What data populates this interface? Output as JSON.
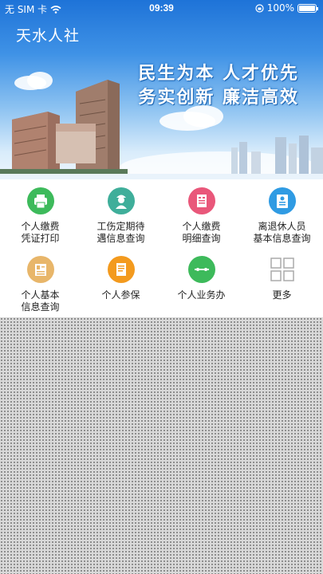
{
  "status": {
    "carrier": "无 SIM 卡",
    "time": "09:39",
    "battery": "100%",
    "battery_level": 1.0
  },
  "header": {
    "title": "天水人社",
    "slogan_line1": "民生为本 人才优先",
    "slogan_line2": "务实创新 廉洁高效"
  },
  "menu": [
    {
      "label": "个人缴费\n凭证打印",
      "icon": "printer-icon",
      "color": "#3dba5b"
    },
    {
      "label": "工伤定期待\n遇信息查询",
      "icon": "worker-icon",
      "color": "#3fae9a"
    },
    {
      "label": "个人缴费\n明细查询",
      "icon": "receipt-icon",
      "color": "#e9577a"
    },
    {
      "label": "离退休人员\n基本信息查询",
      "icon": "id-card-icon",
      "color": "#2f9be3"
    },
    {
      "label": "个人基本\n信息查询",
      "icon": "profile-card-icon",
      "color": "#e8b66a"
    },
    {
      "label": "个人参保",
      "icon": "document-icon",
      "color": "#f39a1e"
    },
    {
      "label": "个人业务办",
      "icon": "connect-icon",
      "color": "#3dba5b"
    },
    {
      "label": "更多",
      "icon": "more-grid-icon",
      "color": "#aaaaaa"
    }
  ]
}
